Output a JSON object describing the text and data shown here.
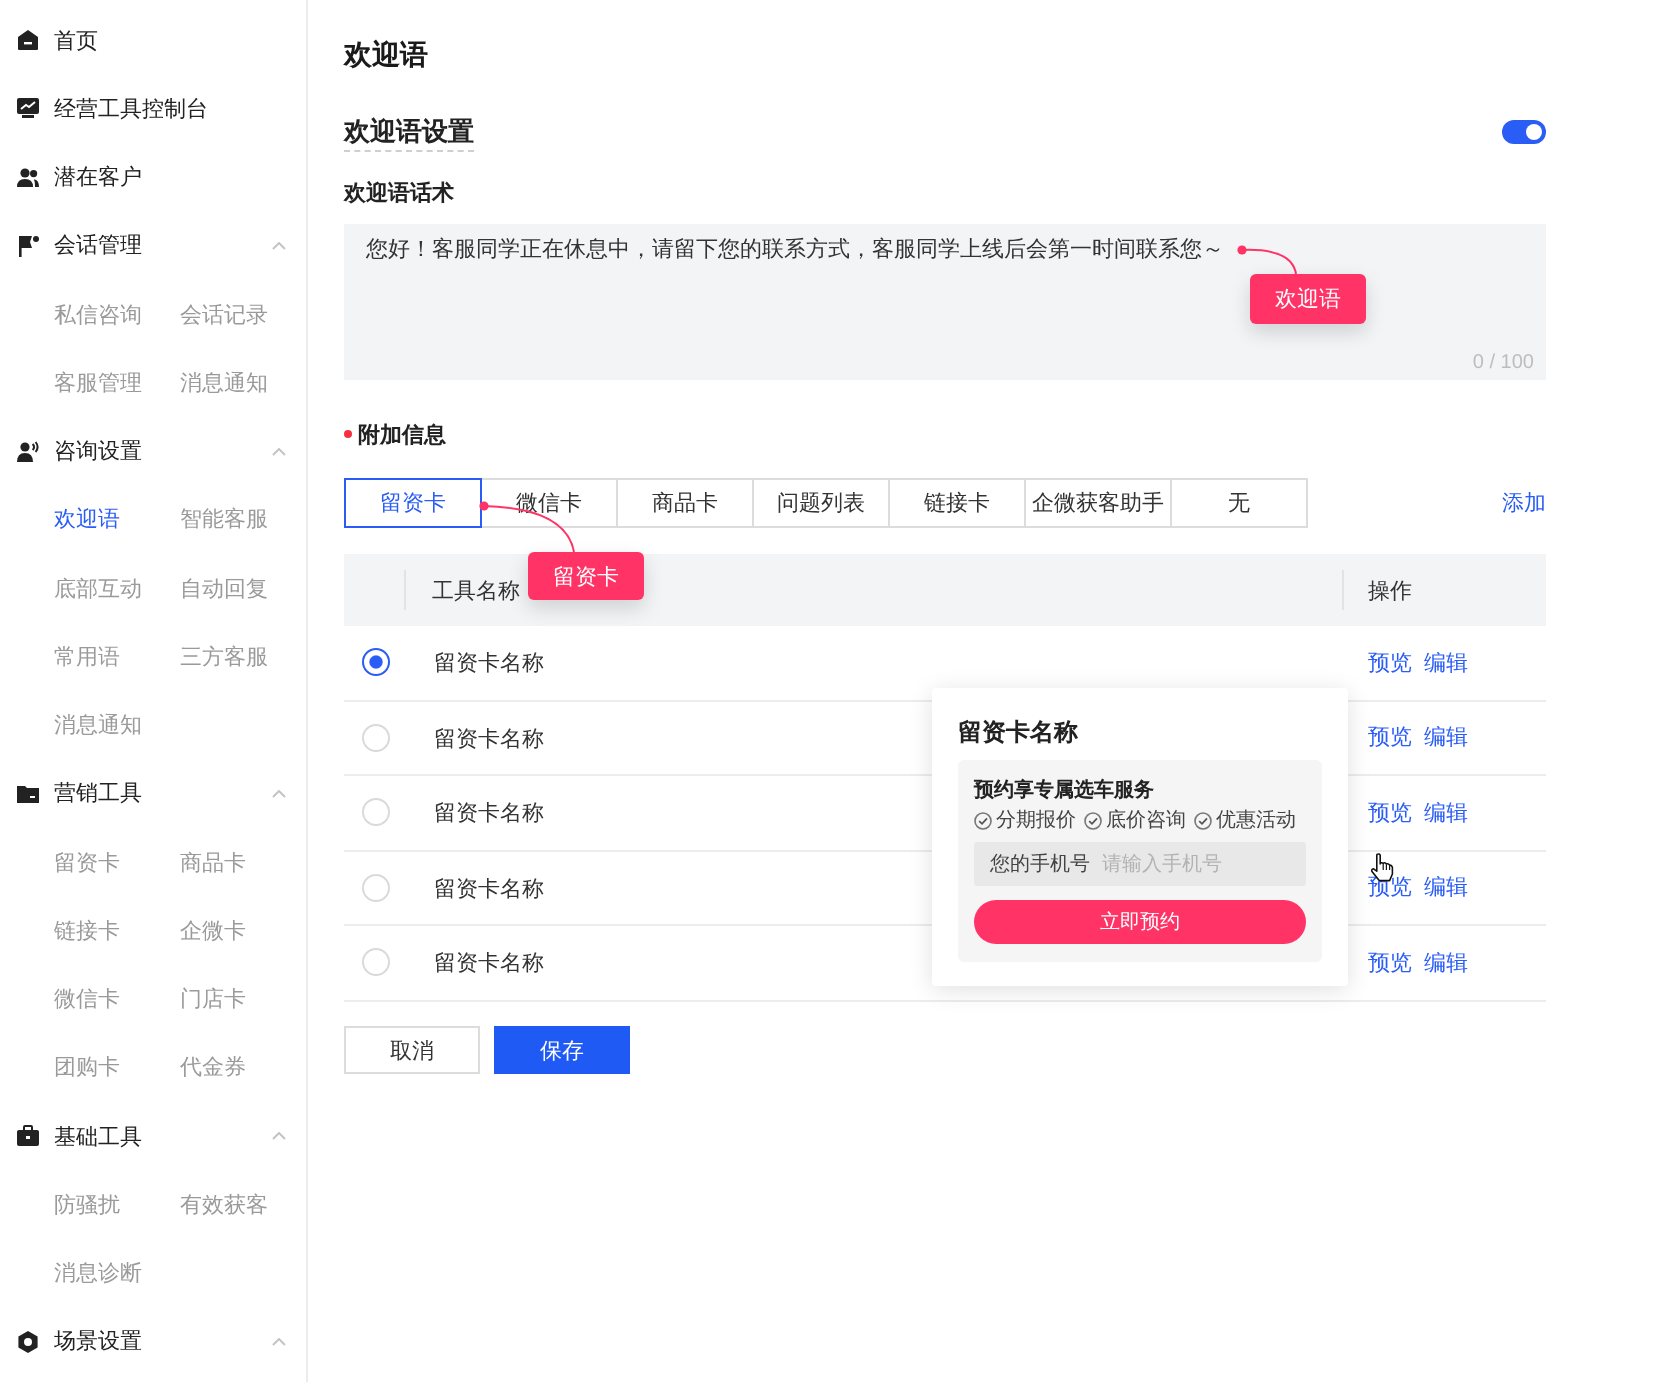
{
  "sidebar": {
    "items": [
      {
        "kind": "link",
        "label": "首页"
      },
      {
        "kind": "link",
        "label": "经营工具控制台"
      },
      {
        "kind": "link",
        "label": "潜在客户"
      },
      {
        "kind": "group",
        "label": "会话管理",
        "expanded": true,
        "children": [
          {
            "label": "私信咨询",
            "selected": false
          },
          {
            "label": "会话记录",
            "selected": false
          },
          {
            "label": "客服管理",
            "selected": false
          },
          {
            "label": "消息通知",
            "selected": false
          }
        ]
      },
      {
        "kind": "group",
        "label": "咨询设置",
        "expanded": true,
        "children": [
          {
            "label": "欢迎语",
            "selected": true
          },
          {
            "label": "智能客服",
            "selected": false
          },
          {
            "label": "底部互动",
            "selected": false
          },
          {
            "label": "自动回复",
            "selected": false
          },
          {
            "label": "常用语",
            "selected": false
          },
          {
            "label": "三方客服",
            "selected": false
          },
          {
            "label": "消息通知",
            "selected": false
          }
        ]
      },
      {
        "kind": "group",
        "label": "营销工具",
        "expanded": true,
        "children": [
          {
            "label": "留资卡",
            "selected": false
          },
          {
            "label": "商品卡",
            "selected": false
          },
          {
            "label": "链接卡",
            "selected": false
          },
          {
            "label": "企微卡",
            "selected": false
          },
          {
            "label": "微信卡",
            "selected": false
          },
          {
            "label": "门店卡",
            "selected": false
          },
          {
            "label": "团购卡",
            "selected": false
          },
          {
            "label": "代金券",
            "selected": false
          }
        ]
      },
      {
        "kind": "group",
        "label": "基础工具",
        "expanded": true,
        "children": [
          {
            "label": "防骚扰",
            "selected": false
          },
          {
            "label": "有效获客",
            "selected": false
          },
          {
            "label": "消息诊断",
            "selected": false
          }
        ]
      },
      {
        "kind": "group",
        "label": "场景设置",
        "expanded": true
      }
    ]
  },
  "page_title": "欢迎语",
  "welcome_settings": {
    "title": "欢迎语设置",
    "enabled": true
  },
  "script": {
    "label": "欢迎语话术",
    "value": "您好！客服同学正在休息中，请留下您的联系方式，客服同学上线后会第一时间联系您～",
    "counter": "0 / 100",
    "callout": "欢迎语"
  },
  "attachment": {
    "label": "附加信息",
    "required": true,
    "tabs": [
      {
        "label": "留资卡",
        "selected": true
      },
      {
        "label": "微信卡",
        "selected": false
      },
      {
        "label": "商品卡",
        "selected": false
      },
      {
        "label": "问题列表",
        "selected": false
      },
      {
        "label": "链接卡",
        "selected": false
      },
      {
        "label": "企微获客助手",
        "selected": false
      },
      {
        "label": "无",
        "selected": false
      }
    ],
    "add_link": "添加",
    "callout": "留资卡",
    "table": {
      "columns": [
        "工具名称",
        "操作"
      ],
      "rows": [
        {
          "name": "留资卡名称",
          "selected": true,
          "actions": [
            "预览",
            "编辑"
          ]
        },
        {
          "name": "留资卡名称",
          "selected": false,
          "actions": [
            "预览",
            "编辑"
          ]
        },
        {
          "name": "留资卡名称",
          "selected": false,
          "actions": [
            "预览",
            "编辑"
          ]
        },
        {
          "name": "留资卡名称",
          "selected": false,
          "actions": [
            "预览",
            "编辑"
          ]
        },
        {
          "name": "留资卡名称",
          "selected": false,
          "actions": [
            "预览",
            "编辑"
          ]
        }
      ]
    }
  },
  "preview_popover": {
    "title": "留资卡名称",
    "headline": "预约享专属选车服务",
    "features": [
      "分期报价",
      "底价咨询",
      "优惠活动"
    ],
    "phone_label": "您的手机号",
    "phone_placeholder": "请输入手机号",
    "submit": "立即预约"
  },
  "buttons": [
    {
      "label": "取消",
      "kind": "secondary"
    },
    {
      "label": "保存",
      "kind": "primary"
    }
  ]
}
